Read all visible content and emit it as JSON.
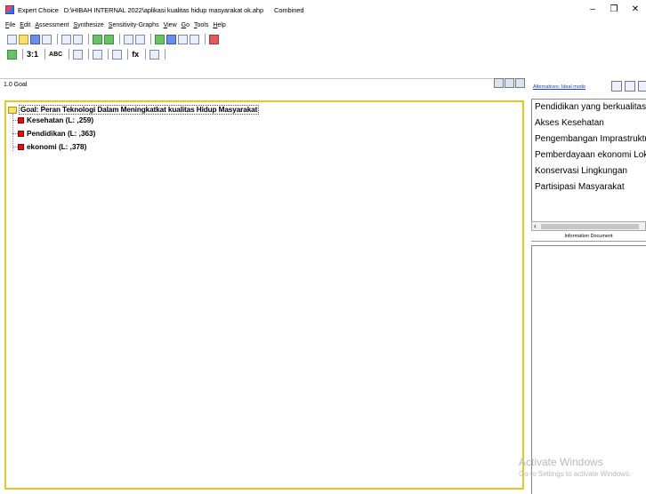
{
  "window": {
    "app_name": "Expert Choice",
    "file_path": "D:\\HIBAH INTERNAL 2022\\aplikasi kualitas hidup masyarakat ok.ahp",
    "mode": "Combined",
    "minimize": "–",
    "maximize": "❐",
    "close": "✕"
  },
  "menu": [
    "File",
    "Edit",
    "Assessment",
    "Synthesize",
    "Sensitivity-Graphs",
    "View",
    "Go",
    "Tools",
    "Help"
  ],
  "toolbar2": {
    "btn_31": "3:1",
    "btn_abc": "ABC",
    "btn_fx": "fx"
  },
  "path_bar": {
    "node_path": "1.0 Goal"
  },
  "tree": {
    "goal": "Goal: Peran Teknologi Dalam Meningkatkat kualitas Hidup Masyarakat",
    "criteria": [
      {
        "label": "Kesehatan (L: ,259)"
      },
      {
        "label": "Pendidikan (L: ,363)"
      },
      {
        "label": "ekonomi (L: ,378)"
      }
    ]
  },
  "right_panel": {
    "mode_link": "Alternatives: Ideal mode",
    "alternatives": [
      "Pendidikan yang berkualitas",
      "Akses Kesehatan",
      "Pengembangan Imprastruktur",
      "Pemberdayaan ekonomi Lokal",
      "Konservasi Lingkungan",
      "Partisipasi Masyarakat"
    ],
    "scroll_left": "‹",
    "info_tab": "Information Document"
  },
  "watermark": {
    "line1": "Activate Windows",
    "line2": "Go to Settings to activate Windows."
  },
  "colors": {
    "tree_border": "#e8c820",
    "node_square": "#e01010",
    "link": "#1a3dc0"
  }
}
